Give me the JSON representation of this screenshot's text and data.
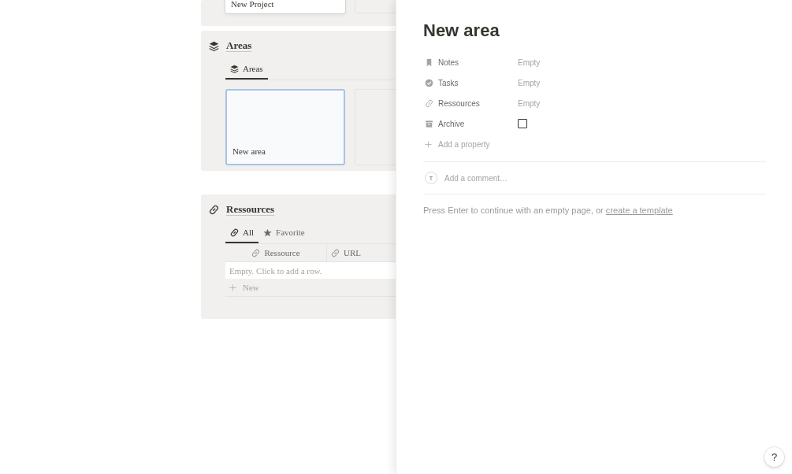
{
  "top_board": {
    "cards": [
      {
        "title": "New Project"
      }
    ]
  },
  "areas": {
    "title": "Areas",
    "tabs": [
      {
        "label": "Areas",
        "selected": true
      }
    ],
    "cards": [
      {
        "title": "New area",
        "selected": true
      }
    ]
  },
  "ressources": {
    "title": "Ressources",
    "tabs": [
      {
        "label": "All",
        "selected": true
      },
      {
        "label": "Favorite",
        "selected": false
      }
    ],
    "columns": [
      "Ressource",
      "URL"
    ],
    "empty_text": "Empty. Click to add a row.",
    "new_label": "New"
  },
  "page": {
    "title": "New area",
    "properties": [
      {
        "label": "Notes",
        "kind": "text",
        "value": "Empty"
      },
      {
        "label": "Tasks",
        "kind": "text",
        "value": "Empty"
      },
      {
        "label": "Ressources",
        "kind": "text",
        "value": "Empty"
      },
      {
        "label": "Archive",
        "kind": "checkbox",
        "checked": false
      }
    ],
    "add_property": "Add a property",
    "avatar": "T",
    "comment_placeholder": "Add a comment…",
    "hint": "Press Enter to continue with an empty page, or",
    "hint_link": "create a template"
  },
  "help": "?"
}
